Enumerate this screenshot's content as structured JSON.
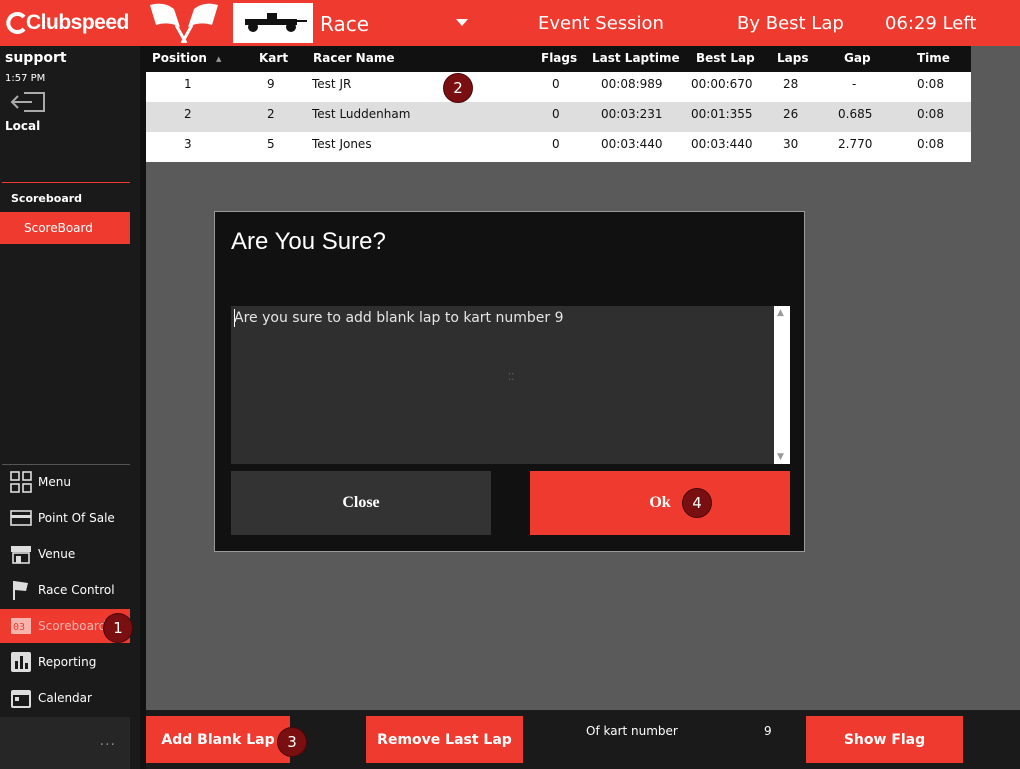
{
  "topbar": {
    "brand": "Clubspeed",
    "mode": "Race",
    "session": "Event Session",
    "sort": "By Best Lap",
    "time_left": "06:29 Left"
  },
  "user": {
    "name": "support",
    "time": "1:57 PM",
    "location": "Local"
  },
  "sidebar": {
    "section_title": "Scoreboard",
    "section_item": "ScoreBoard",
    "nav": [
      {
        "label": "Menu",
        "icon": "grid-icon"
      },
      {
        "label": "Point Of Sale",
        "icon": "credit-card-icon"
      },
      {
        "label": "Venue",
        "icon": "store-icon"
      },
      {
        "label": "Race Control",
        "icon": "flag-icon"
      },
      {
        "label": "Scoreboard",
        "icon": "scoreboard-icon",
        "active": true
      },
      {
        "label": "Reporting",
        "icon": "chart-icon"
      },
      {
        "label": "Calendar",
        "icon": "calendar-icon"
      }
    ],
    "more": "..."
  },
  "table": {
    "headers": {
      "position": "Position",
      "kart": "Kart",
      "racer": "Racer Name",
      "flags": "Flags",
      "last_laptime": "Last Laptime",
      "best_lap": "Best Lap",
      "laps": "Laps",
      "gap": "Gap",
      "time": "Time"
    },
    "rows": [
      {
        "position": "1",
        "kart": "9",
        "racer": "Test JR",
        "flags": "0",
        "last_laptime": "00:08:989",
        "best_lap": "00:00:670",
        "laps": "28",
        "gap": "-",
        "time": "0:08"
      },
      {
        "position": "2",
        "kart": "2",
        "racer": "Test Luddenham",
        "flags": "0",
        "last_laptime": "00:03:231",
        "best_lap": "00:01:355",
        "laps": "26",
        "gap": "0.685",
        "time": "0:08"
      },
      {
        "position": "3",
        "kart": "5",
        "racer": "Test Jones",
        "flags": "0",
        "last_laptime": "00:03:440",
        "best_lap": "00:03:440",
        "laps": "30",
        "gap": "2.770",
        "time": "0:08"
      }
    ]
  },
  "modal": {
    "title": "Are You Sure?",
    "message": "Are you sure to add blank lap to kart number 9",
    "close_label": "Close",
    "ok_label": "Ok"
  },
  "bottombar": {
    "add_blank_lap": "Add Blank Lap",
    "remove_last_lap": "Remove Last Lap",
    "of_kart_label": "Of kart number",
    "kart_number": "9",
    "show_flag": "Show Flag"
  },
  "markers": [
    "1",
    "2",
    "3",
    "4"
  ],
  "colors": {
    "accent": "#ef3b2f",
    "sidebar": "#1a1a1a",
    "background": "#5a5a5a",
    "marker": "#7a0f12"
  }
}
